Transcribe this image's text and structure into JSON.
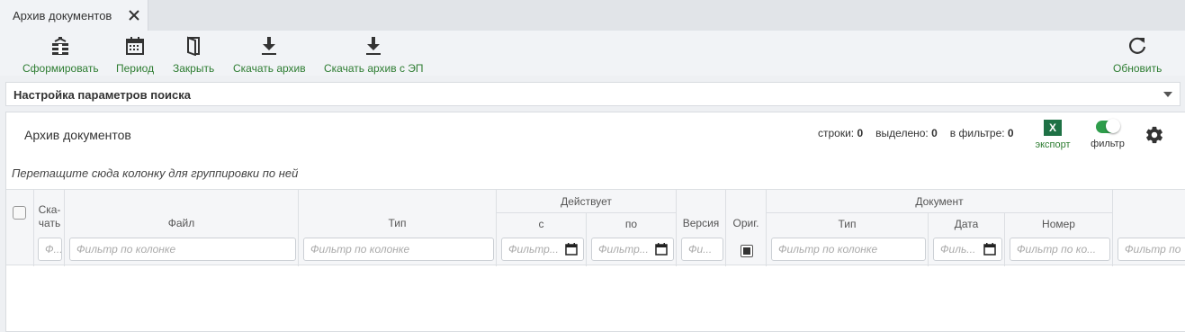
{
  "tab": {
    "title": "Архив документов"
  },
  "toolbar": {
    "form_label": "Сформировать",
    "period_label": "Период",
    "close_label": "Закрыть",
    "download_label": "Скачать архив",
    "download_ep_label": "Скачать архив с ЭП",
    "refresh_label": "Обновить"
  },
  "search_panel": {
    "title": "Настройка параметров поиска"
  },
  "grid": {
    "title": "Архив документов",
    "rows_label": "строки:",
    "rows_value": "0",
    "selected_label": "выделено:",
    "selected_value": "0",
    "filtered_label": "в фильтре:",
    "filtered_value": "0",
    "export_label": "экспорт",
    "export_icon_text": "X",
    "filter_label": "фильтр",
    "group_hint": "Перетащите сюда колонку для группировки по ней",
    "headers": {
      "download": "Ска-\nчать",
      "file": "Файл",
      "type": "Тип",
      "active_group": "Действует",
      "from": "с",
      "to": "по",
      "version": "Версия",
      "orig": "Ориг.",
      "document_group": "Документ",
      "doc_type": "Тип",
      "doc_date": "Дата",
      "doc_number": "Номер"
    },
    "filters": {
      "download": "Ф...",
      "file": "Фильтр по колонке",
      "type": "Фильтр по колонке",
      "from": "Фильтр...",
      "to": "Фильтр...",
      "version": "Фи...",
      "doc_type": "Фильтр по колонке",
      "doc_date": "Филь...",
      "doc_number": "Фильтр по ко...",
      "extra": "Фильтр по"
    }
  },
  "colors": {
    "accent": "#2e7d32",
    "excel": "#1e7145",
    "toggle_on": "#2e9d4b"
  }
}
